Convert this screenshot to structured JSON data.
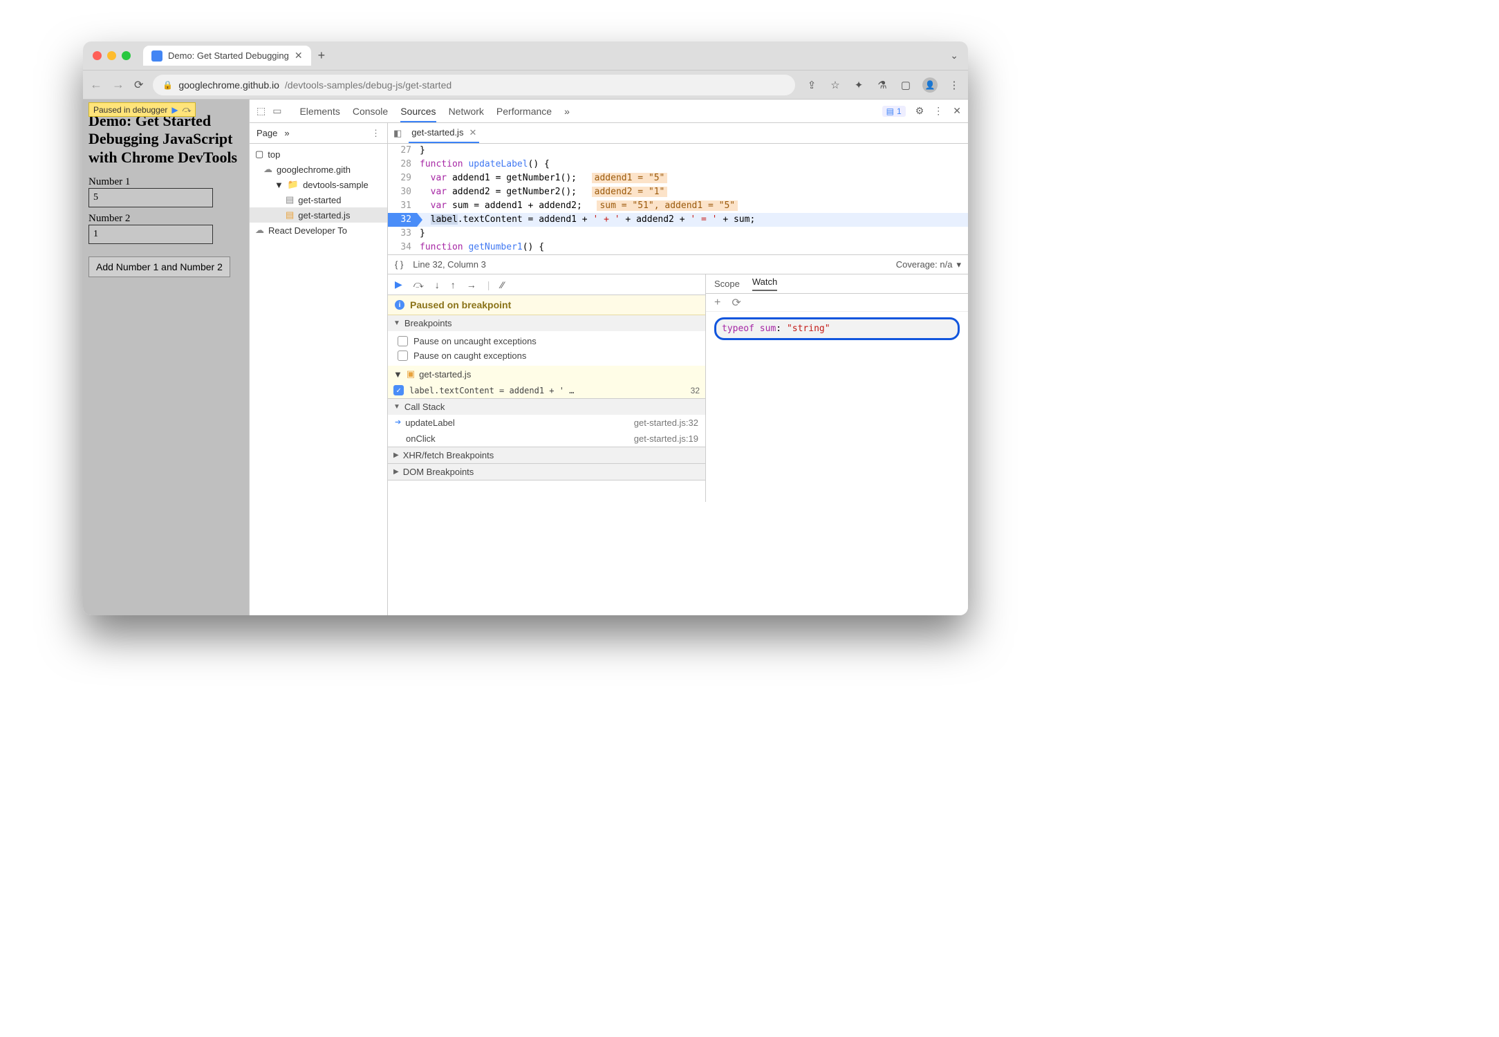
{
  "browser": {
    "tab_title": "Demo: Get Started Debugging",
    "url_host": "googlechrome.github.io",
    "url_path": "/devtools-samples/debug-js/get-started"
  },
  "page": {
    "paused_overlay": "Paused in debugger",
    "heading": "Demo: Get Started Debugging JavaScript with Chrome DevTools",
    "label1": "Number 1",
    "value1": "5",
    "label2": "Number 2",
    "value2": "1",
    "button": "Add Number 1 and Number 2"
  },
  "devtools": {
    "tabs": {
      "elements": "Elements",
      "console": "Console",
      "sources": "Sources",
      "network": "Network",
      "performance": "Performance",
      "more": "»"
    },
    "issues_count": "1",
    "navigator": {
      "page": "Page",
      "top": "top",
      "host": "googlechrome.gith",
      "folder": "devtools-sample",
      "html": "get-started",
      "js": "get-started.js",
      "ext": "React Developer To"
    },
    "editor": {
      "file": "get-started.js",
      "lines": [
        {
          "n": "27",
          "t": "}"
        },
        {
          "n": "28",
          "t": "function updateLabel() {"
        },
        {
          "n": "29",
          "t": "  var addend1 = getNumber1();",
          "inl": "addend1 = \"5\""
        },
        {
          "n": "30",
          "t": "  var addend2 = getNumber2();",
          "inl": "addend2 = \"1\""
        },
        {
          "n": "31",
          "t": "  var sum = addend1 + addend2;",
          "inl": "sum = \"51\", addend1 = \"5\""
        },
        {
          "n": "32",
          "t": "  label.textContent = addend1 + ' + ' + addend2 + ' = ' + sum;",
          "bp": true
        },
        {
          "n": "33",
          "t": "}"
        },
        {
          "n": "34",
          "t": "function getNumber1() {"
        }
      ],
      "status_left": "Line 32, Column 3",
      "coverage": "Coverage: n/a"
    },
    "debugger": {
      "paused_msg": "Paused on breakpoint",
      "sections": {
        "breakpoints": "Breakpoints",
        "uncaught": "Pause on uncaught exceptions",
        "caught": "Pause on caught exceptions",
        "bp_file": "get-started.js",
        "bp_text": "label.textContent = addend1 + ' …",
        "bp_line": "32",
        "callstack": "Call Stack",
        "stack": [
          {
            "fn": "updateLabel",
            "loc": "get-started.js:32"
          },
          {
            "fn": "onClick",
            "loc": "get-started.js:19"
          }
        ],
        "xhr": "XHR/fetch Breakpoints",
        "dom": "DOM Breakpoints"
      },
      "scope_tab": "Scope",
      "watch_tab": "Watch",
      "watch_expr": "typeof sum",
      "watch_val": "\"string\""
    }
  }
}
